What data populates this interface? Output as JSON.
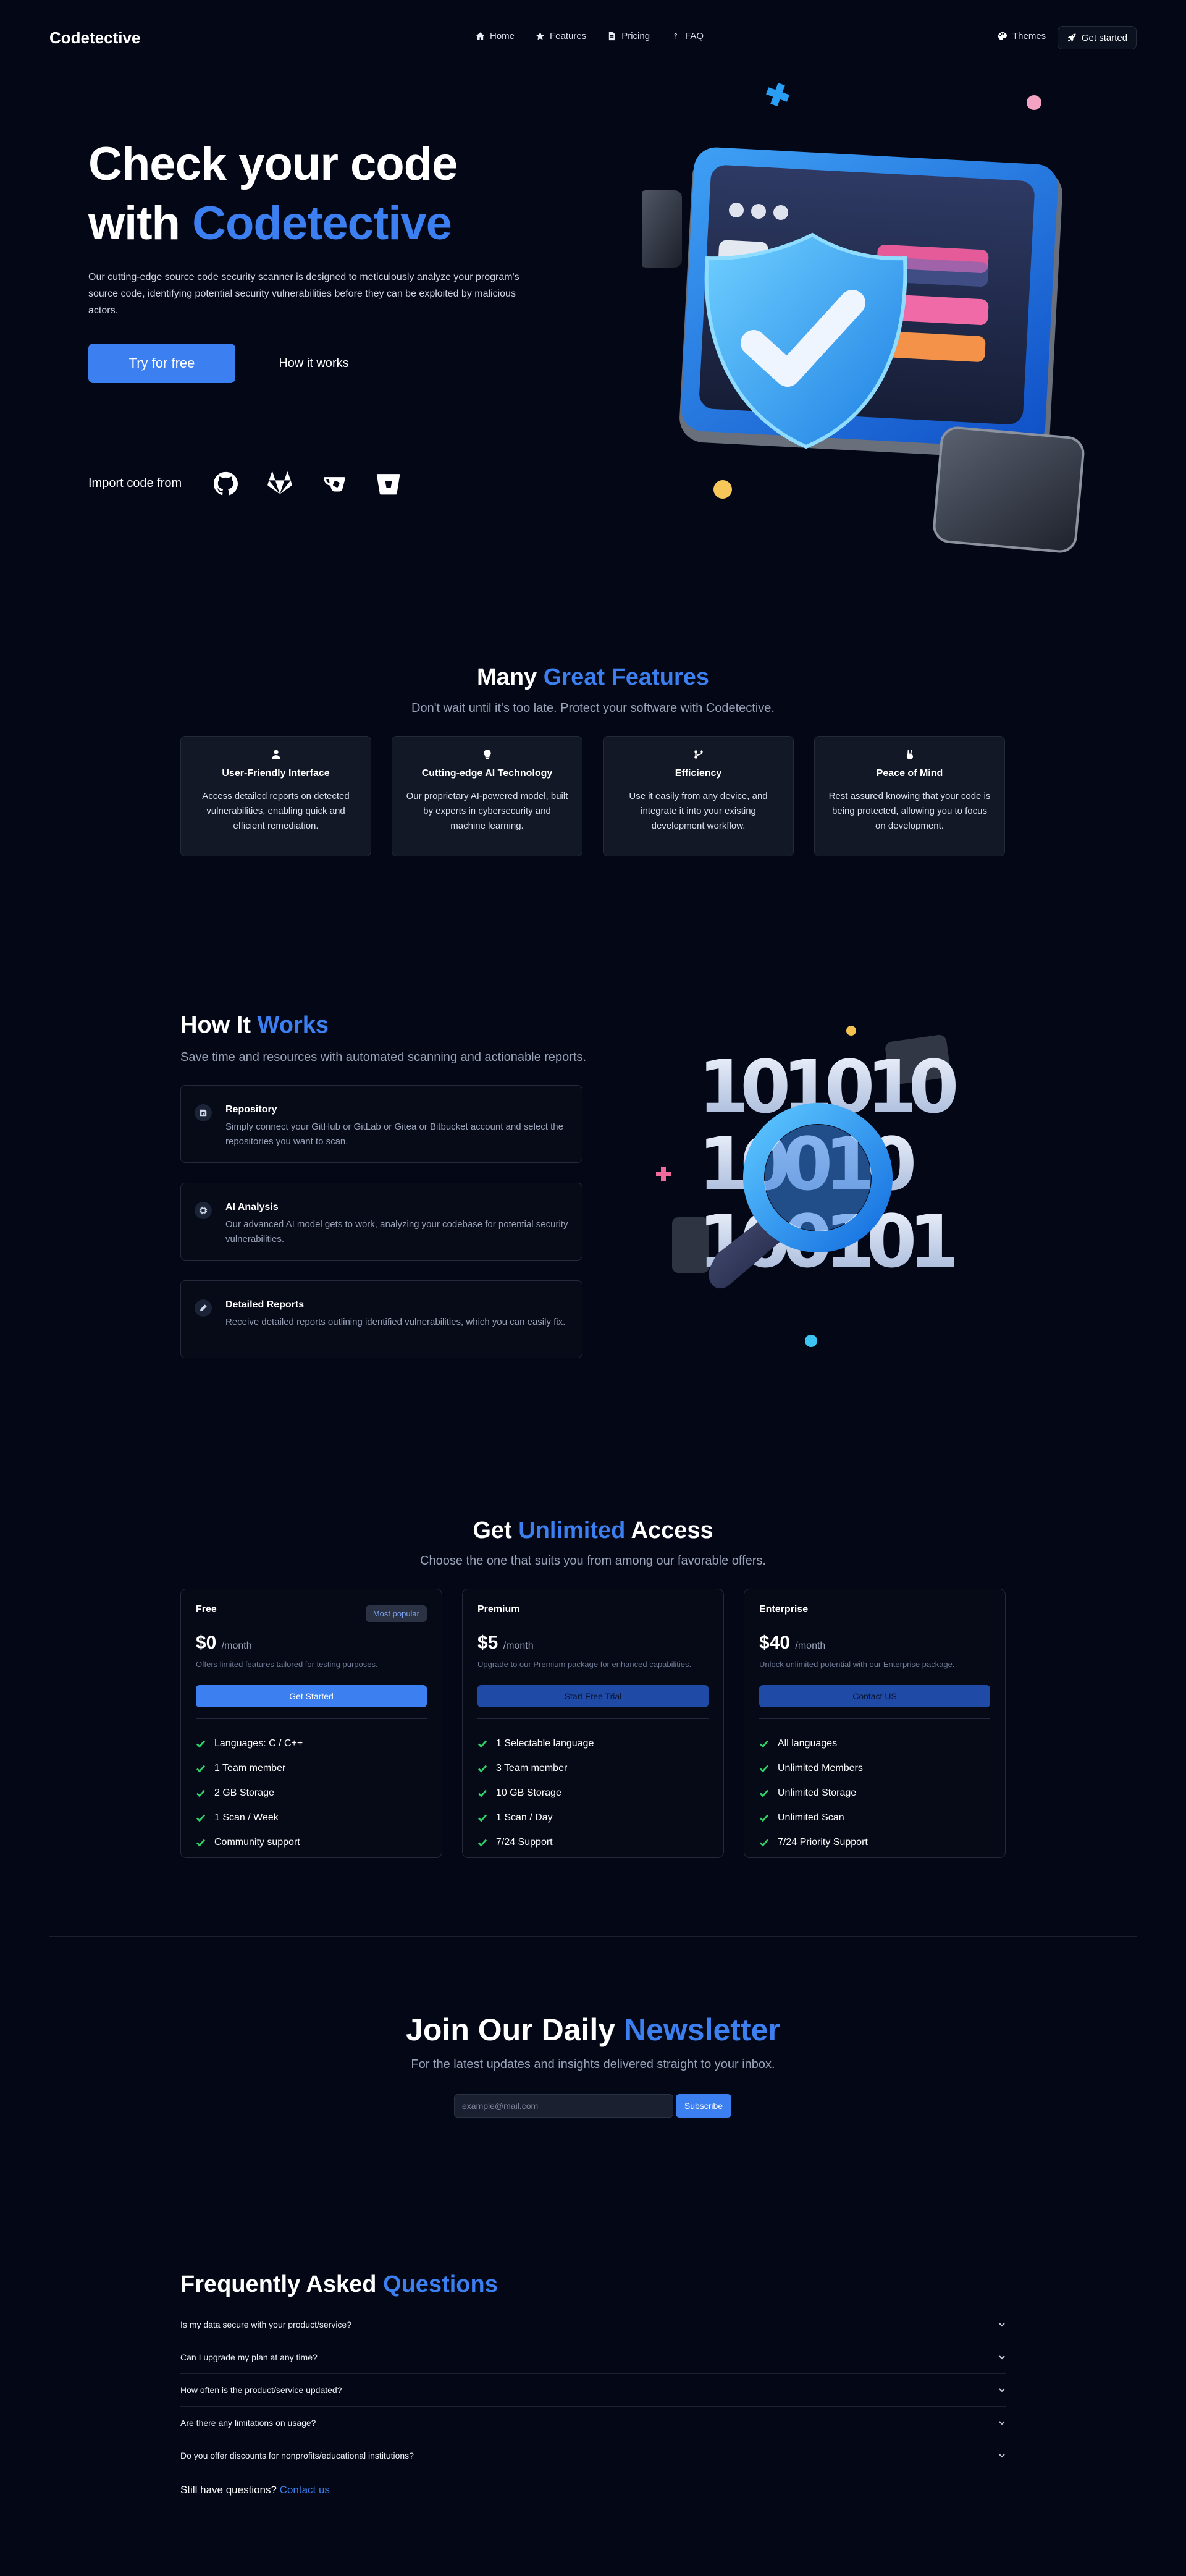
{
  "nav": {
    "brand": "Codetective",
    "links": [
      {
        "label": "Home",
        "icon": "home-icon"
      },
      {
        "label": "Features",
        "icon": "star-icon"
      },
      {
        "label": "Pricing",
        "icon": "document-icon"
      },
      {
        "label": "FAQ",
        "icon": "question-icon"
      }
    ],
    "themes": "Themes",
    "get_started": "Get started"
  },
  "hero": {
    "title_line1": "Check your code",
    "title_with": "with",
    "title_brand": "Codetective",
    "description": "Our cutting-edge source code security scanner is designed to meticulously analyze your program's source code, identifying potential security vulnerabilities before they can be exploited by malicious actors.",
    "try_button": "Try for free",
    "how_button": "How it works",
    "import_label": "Import code from",
    "import_sources": [
      "github-icon",
      "gitlab-icon",
      "gitea-icon",
      "bitbucket-icon"
    ]
  },
  "features": {
    "title_plain": "Many",
    "title_accent": "Great Features",
    "subtitle": "Don't wait until it's too late. Protect your software with Codetective.",
    "cards": [
      {
        "icon": "user-icon",
        "title": "User-Friendly Interface",
        "text": "Access detailed reports on detected vulnerabilities, enabling quick and efficient remediation."
      },
      {
        "icon": "bulb-icon",
        "title": "Cutting-edge AI Technology",
        "text": "Our proprietary AI-powered model, built by experts in cybersecurity and machine learning."
      },
      {
        "icon": "branch-icon",
        "title": "Efficiency",
        "text": "Use it easily from any device, and integrate it into your existing development workflow."
      },
      {
        "icon": "peace-hand-icon",
        "title": "Peace of Mind",
        "text": "Rest assured knowing that your code is being protected, allowing you to focus on development."
      }
    ]
  },
  "how": {
    "title_plain": "How It",
    "title_accent": "Works",
    "subtitle": "Save time and resources with automated scanning and actionable reports.",
    "steps": [
      {
        "icon": "repository-icon",
        "title": "Repository",
        "text": "Simply connect your GitHub or GitLab or Gitea or Bitbucket account and select the repositories you want to scan."
      },
      {
        "icon": "ai-chip-icon",
        "title": "AI Analysis",
        "text": "Our advanced AI model gets to work, analyzing your codebase for potential security vulnerabilities."
      },
      {
        "icon": "report-pen-icon",
        "title": "Detailed Reports",
        "text": "Receive detailed reports outlining identified vulnerabilities, which you can easily fix."
      }
    ],
    "art_digits": [
      "101010",
      "10010",
      "100101"
    ]
  },
  "pricing": {
    "title_plain": "Get",
    "title_accent": "Unlimited",
    "title_end": "Access",
    "subtitle": "Choose the one that suits you from among our favorable offers.",
    "plans": [
      {
        "name": "Free",
        "badge": "Most popular",
        "price": "$0",
        "period": "/month",
        "desc": "Offers limited features tailored for testing purposes.",
        "button": "Get Started",
        "features": [
          "Languages: C / C++",
          "1 Team member",
          "2 GB Storage",
          "1 Scan / Week",
          "Community support"
        ]
      },
      {
        "name": "Premium",
        "badge": "",
        "price": "$5",
        "period": "/month",
        "desc": "Upgrade to our Premium package for enhanced capabilities.",
        "button": "Start Free Trial",
        "features": [
          "1 Selectable language",
          "3 Team member",
          "10 GB Storage",
          "1 Scan / Day",
          "7/24 Support"
        ]
      },
      {
        "name": "Enterprise",
        "badge": "",
        "price": "$40",
        "period": "/month",
        "desc": "Unlock unlimited potential with our Enterprise package.",
        "button": "Contact US",
        "features": [
          "All languages",
          "Unlimited Members",
          "Unlimited Storage",
          "Unlimited Scan",
          "7/24 Priority Support"
        ]
      }
    ]
  },
  "newsletter": {
    "title_plain": "Join Our Daily",
    "title_accent": "Newsletter",
    "subtitle": "For the latest updates and insights delivered straight to your inbox.",
    "placeholder": "example@mail.com",
    "button": "Subscribe"
  },
  "faq": {
    "title_plain": "Frequently Asked",
    "title_accent": "Questions",
    "items": [
      "Is my data secure with your product/service?",
      "Can I upgrade my plan at any time?",
      "How often is the product/service updated?",
      "Are there any limitations on usage?",
      "Do you offer discounts for nonprofits/educational institutions?"
    ],
    "still_text": "Still have questions?",
    "contact_link": "Contact us"
  },
  "colors": {
    "accent": "#3b7ff0",
    "background": "#040816",
    "card": "#121826",
    "check": "#2fd36a"
  }
}
